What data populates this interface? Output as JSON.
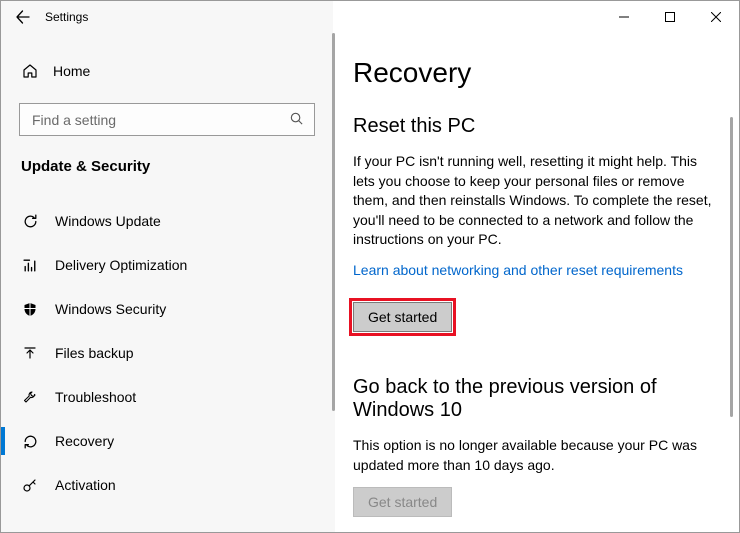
{
  "titlebar": {
    "title": "Settings"
  },
  "sidebar": {
    "home": "Home",
    "search_placeholder": "Find a setting",
    "category": "Update & Security",
    "items": [
      {
        "label": "Windows Update"
      },
      {
        "label": "Delivery Optimization"
      },
      {
        "label": "Windows Security"
      },
      {
        "label": "Files backup"
      },
      {
        "label": "Troubleshoot"
      },
      {
        "label": "Recovery"
      },
      {
        "label": "Activation"
      }
    ]
  },
  "content": {
    "title": "Recovery",
    "reset": {
      "heading": "Reset this PC",
      "body": "If your PC isn't running well, resetting it might help. This lets you choose to keep your personal files or remove them, and then reinstalls Windows. To complete the reset, you'll need to be connected to a network and follow the instructions on your PC.",
      "link": "Learn about networking and other reset requirements",
      "button": "Get started"
    },
    "goback": {
      "heading": "Go back to the previous version of Windows 10",
      "body": "This option is no longer available because your PC was updated more than 10 days ago.",
      "button": "Get started"
    }
  }
}
